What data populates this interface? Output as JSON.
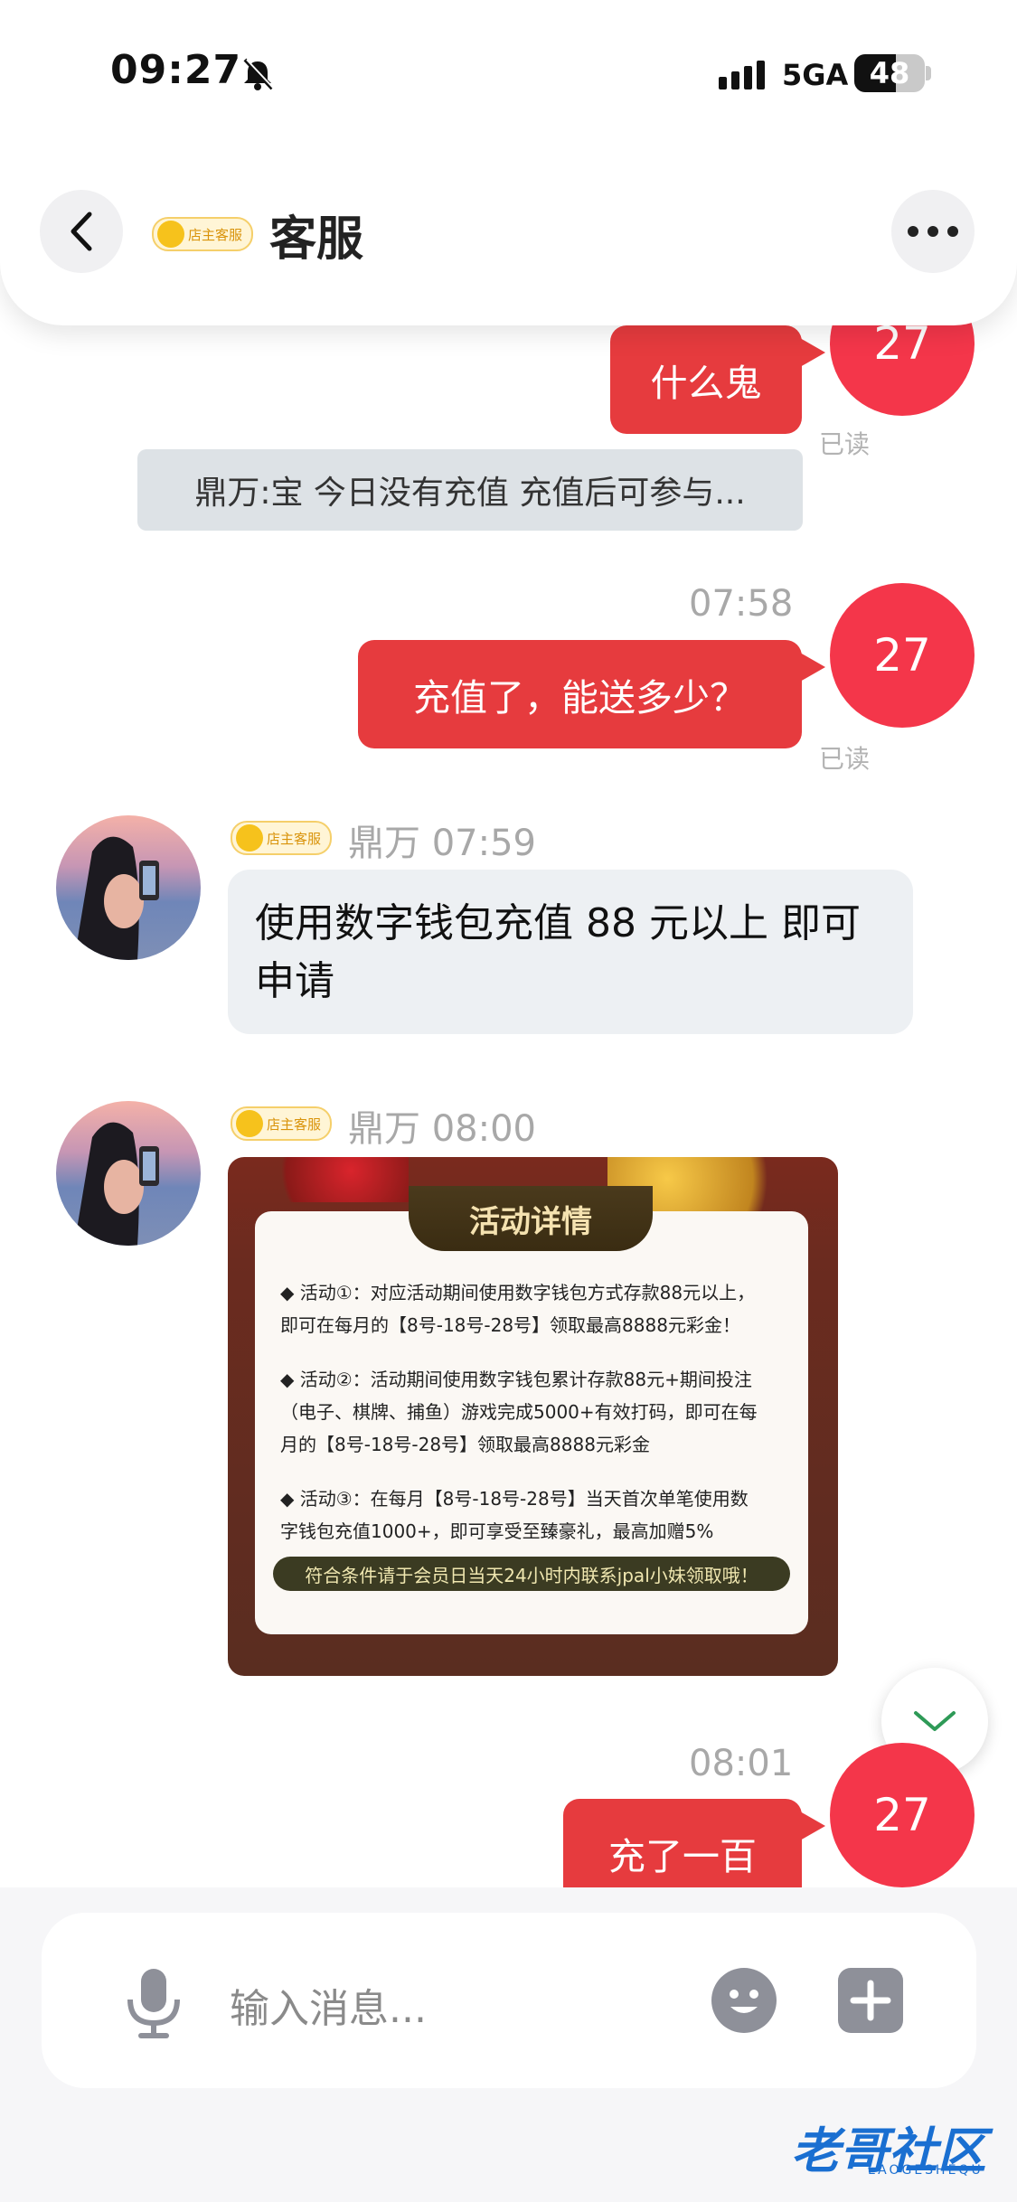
{
  "status_bar": {
    "time": "09:27",
    "network": "5GA",
    "battery": "48"
  },
  "header": {
    "badge": "店主客服",
    "title": "客服"
  },
  "messages": {
    "m1": {
      "text": "什么鬼",
      "avatar": "27",
      "status": "已读"
    },
    "sys": {
      "text": "鼎万:宝 今日没有充值 充值后可参与..."
    },
    "m2": {
      "time": "07:58",
      "text": "充值了，能送多少？",
      "avatar": "27",
      "status": "已读"
    },
    "m3": {
      "badge": "店主客服",
      "sender_time": "鼎万 07:59",
      "text": "使用数字钱包充值 88 元以上 即可申请"
    },
    "m4": {
      "badge": "店主客服",
      "sender_time": "鼎万 08:00"
    },
    "m5": {
      "time": "08:01",
      "text": "充了一百",
      "avatar": "27"
    }
  },
  "promo": {
    "title": "活动详情",
    "line1": "◆ 活动①：对应活动期间使用数字钱包方式存款88元以上，",
    "line2": "即可在每月的【8号-18号-28号】领取最高8888元彩金！",
    "line3": "◆ 活动②：活动期间使用数字钱包累计存款88元+期间投注",
    "line4": "（电子、棋牌、捕鱼）游戏完成5000+有效打码，即可在每",
    "line5": "月的【8号-18号-28号】领取最高8888元彩金",
    "line6": "◆ 活动③：在每月【8号-18号-28号】当天首次单笔使用数",
    "line7": "字钱包充值1000+，即可享受至臻豪礼，最高加赠5%",
    "footer": "符合条件请于会员日当天24小时内联系jpal小妹领取哦！"
  },
  "input": {
    "placeholder": "输入消息..."
  },
  "watermark": {
    "text": "老哥社区",
    "sub": "LAOGESHEQU"
  }
}
